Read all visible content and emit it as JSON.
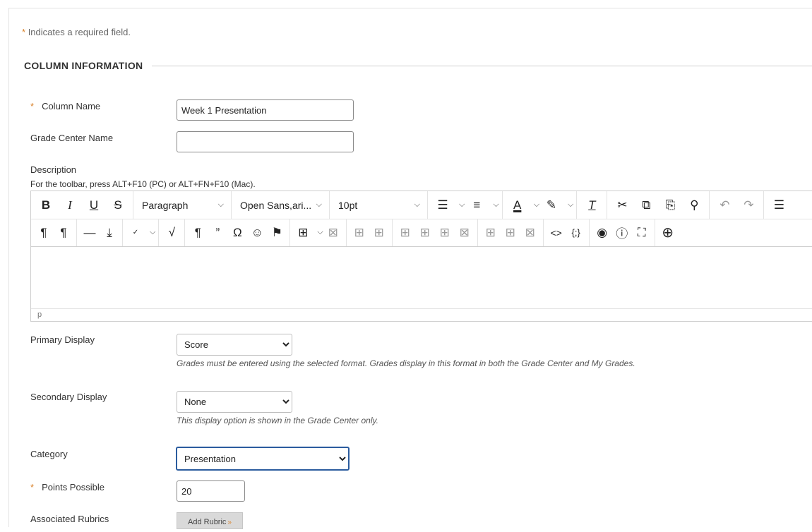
{
  "required_note": {
    "star": "*",
    "text": "Indicates a required field."
  },
  "section": {
    "title": "COLUMN INFORMATION"
  },
  "fields": {
    "column_name": {
      "star": "*",
      "label": "Column Name",
      "value": "Week 1 Presentation"
    },
    "grade_center_name": {
      "label": "Grade Center Name",
      "value": ""
    },
    "description": {
      "label": "Description",
      "help": "For the toolbar, press ALT+F10 (PC) or ALT+FN+F10 (Mac)."
    }
  },
  "editor": {
    "format": "Paragraph",
    "font": "Open Sans,ari...",
    "size": "10pt",
    "status_path": "p",
    "row1_icons": [
      "bold-icon",
      "italic-icon",
      "underline-icon",
      "strikethrough-icon",
      "bulleted-list-icon",
      "numbered-list-icon",
      "text-color-icon",
      "highlight-color-icon",
      "clear-formatting-icon",
      "cut-icon",
      "copy-icon",
      "paste-icon",
      "find-icon",
      "undo-icon",
      "redo-icon",
      "align-left-icon"
    ],
    "row2_icons": [
      "ltr-icon",
      "rtl-icon",
      "horizontal-line-icon",
      "insert-icon",
      "spellcheck-icon",
      "math-icon",
      "paragraph-mark-icon",
      "blockquote-icon",
      "special-char-icon",
      "emoji-icon",
      "bookmark-icon",
      "table-icon",
      "delete-table-icon",
      "row-before-icon",
      "row-after-icon",
      "cell-props-icon",
      "insert-col-icon",
      "insert-cell-icon",
      "delete-cell-icon",
      "merge-icon",
      "split-icon",
      "delete-col-icon",
      "source-code-icon",
      "code-sample-icon",
      "preview-icon",
      "help-icon",
      "fullscreen-icon",
      "add-content-icon"
    ]
  },
  "primary_display": {
    "label": "Primary Display",
    "selected": "Score",
    "hint": "Grades must be entered using the selected format. Grades display in this format in both the Grade Center and My Grades."
  },
  "secondary_display": {
    "label": "Secondary Display",
    "selected": "None",
    "hint": "This display option is shown in the Grade Center only."
  },
  "category": {
    "label": "Category",
    "selected": "Presentation"
  },
  "points_possible": {
    "star": "*",
    "label": "Points Possible",
    "value": "20"
  },
  "associated_rubrics": {
    "label": "Associated Rubrics",
    "button": "Add Rubric"
  },
  "colors": {
    "accent_star": "#d9822b",
    "focus_border": "#2b5c9e"
  }
}
